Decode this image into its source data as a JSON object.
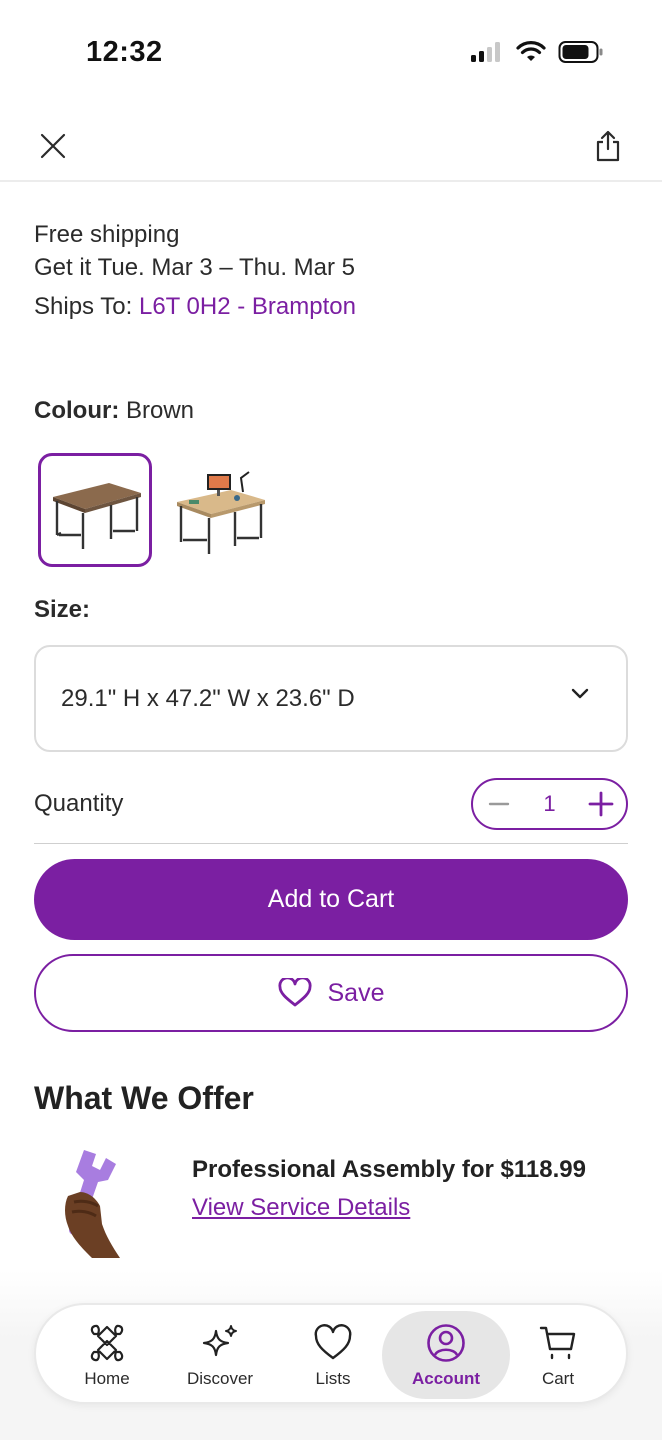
{
  "status_bar": {
    "time": "12:32",
    "icons": [
      "cellular-signal-icon",
      "wifi-icon",
      "battery-icon"
    ]
  },
  "top_nav": {
    "icons": [
      "close-icon",
      "share-icon"
    ]
  },
  "shipping": {
    "free_label": "Free shipping",
    "delivery_estimate": "Get it Tue. Mar 3 – Thu. Mar 5",
    "ships_to_label": "Ships To:",
    "ships_to_value": "L6T 0H2 - Brampton"
  },
  "colour": {
    "label": "Colour:",
    "value": "Brown",
    "swatches": [
      "desk-brown",
      "desk-with-monitor"
    ],
    "selected_index": 0
  },
  "size": {
    "label": "Size:",
    "value": "29.1\" H x 47.2\" W x 23.6\" D"
  },
  "quantity": {
    "label": "Quantity",
    "value": "1"
  },
  "actions": {
    "add_to_cart": "Add to Cart",
    "save": "Save"
  },
  "offer": {
    "heading": "What We Offer",
    "title": "Professional Assembly for $118.99",
    "link": "View Service Details"
  },
  "tab_bar": {
    "items": [
      {
        "label": "Home",
        "icon": "home-icon"
      },
      {
        "label": "Discover",
        "icon": "sparkle-icon"
      },
      {
        "label": "Lists",
        "icon": "heart-icon"
      },
      {
        "label": "Account",
        "icon": "account-icon"
      },
      {
        "label": "Cart",
        "icon": "cart-icon"
      }
    ],
    "active": "Account"
  },
  "colors": {
    "accent": "#7b1fa2",
    "text": "#2b2b2b"
  }
}
